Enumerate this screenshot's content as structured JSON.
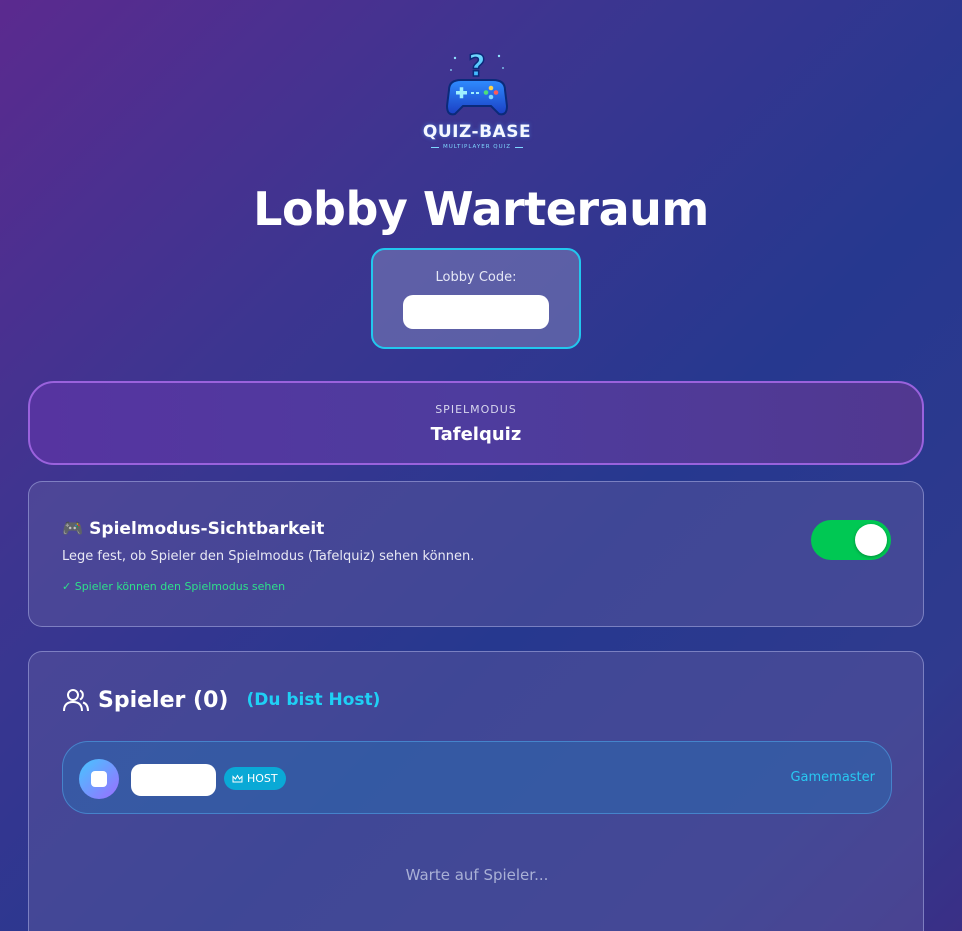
{
  "logo": {
    "title": "QUIZ-BASE",
    "subtitle": "MULTIPLAYER QUIZ"
  },
  "page": {
    "title": "Lobby Warteraum"
  },
  "lobby": {
    "code_label": "Lobby Code:",
    "code_value": ""
  },
  "mode": {
    "label": "SPIELMODUS",
    "value": "Tafelquiz"
  },
  "visibility": {
    "icon": "🎮",
    "title": "Spielmodus-Sichtbarkeit",
    "description": "Lege fest, ob Spieler den Spielmodus (Tafelquiz) sehen können.",
    "status": "✓ Spieler können den Spielmodus sehen",
    "enabled": true,
    "toggle_color": "#00c853"
  },
  "players": {
    "title": "Spieler (0)",
    "host_note": "(Du bist Host)",
    "list": [
      {
        "name": "",
        "badge": "HOST",
        "role": "Gamemaster"
      }
    ],
    "waiting_text": "Warte auf Spieler..."
  }
}
